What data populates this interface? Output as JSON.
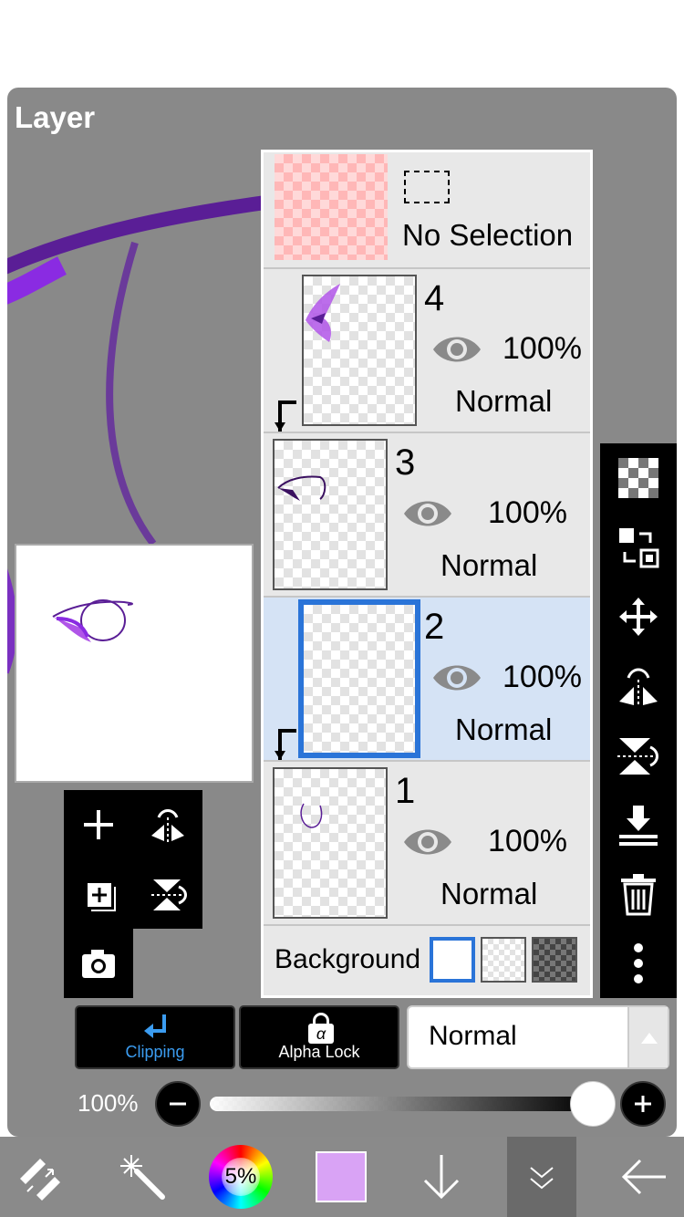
{
  "panel": {
    "title": "Layer"
  },
  "selection_row": {
    "label": "No Selection"
  },
  "layers": [
    {
      "number": "4",
      "opacity": "100%",
      "mode": "Normal",
      "clipped": true,
      "selected": false
    },
    {
      "number": "3",
      "opacity": "100%",
      "mode": "Normal",
      "clipped": false,
      "selected": false
    },
    {
      "number": "2",
      "opacity": "100%",
      "mode": "Normal",
      "clipped": true,
      "selected": true
    },
    {
      "number": "1",
      "opacity": "100%",
      "mode": "Normal",
      "clipped": false,
      "selected": false
    }
  ],
  "background_row": {
    "label": "Background",
    "options": [
      "white",
      "transparent",
      "dark-checker"
    ],
    "selected": "white"
  },
  "controls": {
    "clipping_label": "Clipping",
    "alpha_lock_label": "Alpha Lock",
    "alpha_lock_symbol": "α",
    "blend_mode": "Normal",
    "opacity_label": "100%",
    "opacity_value": 1.0
  },
  "bottom_bar": {
    "brush_size_label": "5%",
    "current_color": "#d9a3f5"
  },
  "colors": {
    "accent": "#2a74d8",
    "selected_row": "#d5e3f5",
    "panel_bg": "#898989",
    "stroke_purple": "#5a1e96"
  },
  "icons": {
    "mini_tools": [
      "plus-icon",
      "flip-horizontal-icon",
      "duplicate-layer-icon",
      "flip-vertical-icon",
      "camera-icon"
    ],
    "right_tools": [
      "checker-icon",
      "swap-icon",
      "move-icon",
      "flip-horizontal-icon",
      "flip-vertical-icon",
      "merge-down-icon",
      "trash-icon",
      "more-icon"
    ],
    "bottom_bar": [
      "transform-icon",
      "magic-wand-icon",
      "color-wheel",
      "color-swatch",
      "arrow-down-icon",
      "collapse-icon",
      "back-arrow-icon"
    ]
  }
}
